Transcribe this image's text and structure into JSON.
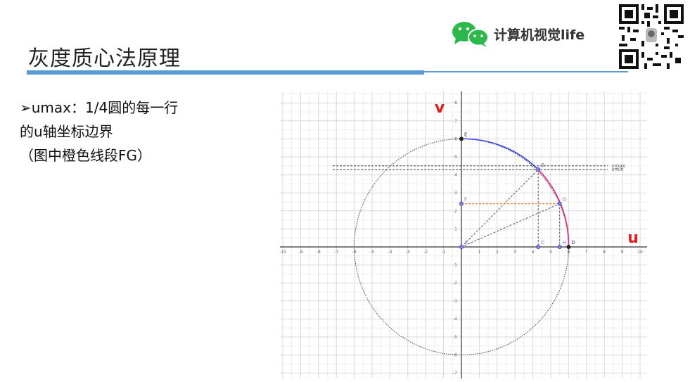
{
  "slide": {
    "title": "灰度质心法原理",
    "brand": "计算机视觉life",
    "bullet_lines": [
      "➢umax：1/4圆的每一行",
      "  的u轴坐标边界",
      " （图中橙色线段FG）"
    ]
  },
  "colors": {
    "accent": "#5b9bd5",
    "arc_blue": "#3344ee",
    "arc_magenta": "#e0207a",
    "axis_label_red": "#e02020",
    "segment_orange": "#f08030",
    "point_fill": "#8080e0",
    "wechat_green": "#2db84c"
  },
  "chart_data": {
    "type": "diagram",
    "axis_labels": {
      "x": "u",
      "y": "v"
    },
    "xlim": [
      -10,
      10
    ],
    "ylim": [
      -7,
      8
    ],
    "grid": true,
    "x_ticks": [
      -10,
      -9,
      -8,
      -7,
      -6,
      -5,
      -4,
      -3,
      -2,
      -1,
      1,
      2,
      3,
      4,
      5,
      6,
      7,
      8,
      9,
      10
    ],
    "y_ticks": [
      8,
      7,
      6,
      5,
      4,
      3,
      2,
      1,
      -1,
      -2,
      -3,
      -4,
      -5,
      -6,
      -7
    ],
    "circle": {
      "center": [
        0,
        0
      ],
      "radius": 6
    },
    "points": [
      {
        "name": "A",
        "x": 0,
        "y": 0
      },
      {
        "name": "B",
        "x": 4.3,
        "y": 4.3
      },
      {
        "name": "C",
        "x": 4.3,
        "y": 0
      },
      {
        "name": "D",
        "x": 6,
        "y": 0
      },
      {
        "name": "E",
        "x": 0,
        "y": 6
      },
      {
        "name": "F",
        "x": 0,
        "y": 2.4
      },
      {
        "name": "G",
        "x": 5.5,
        "y": 2.4
      },
      {
        "name": "H",
        "x": 5.5,
        "y": 0
      }
    ],
    "reference_lines": [
      {
        "label": "vmax",
        "y": 4.5
      },
      {
        "label": "vmin",
        "y": 4.3
      }
    ]
  }
}
